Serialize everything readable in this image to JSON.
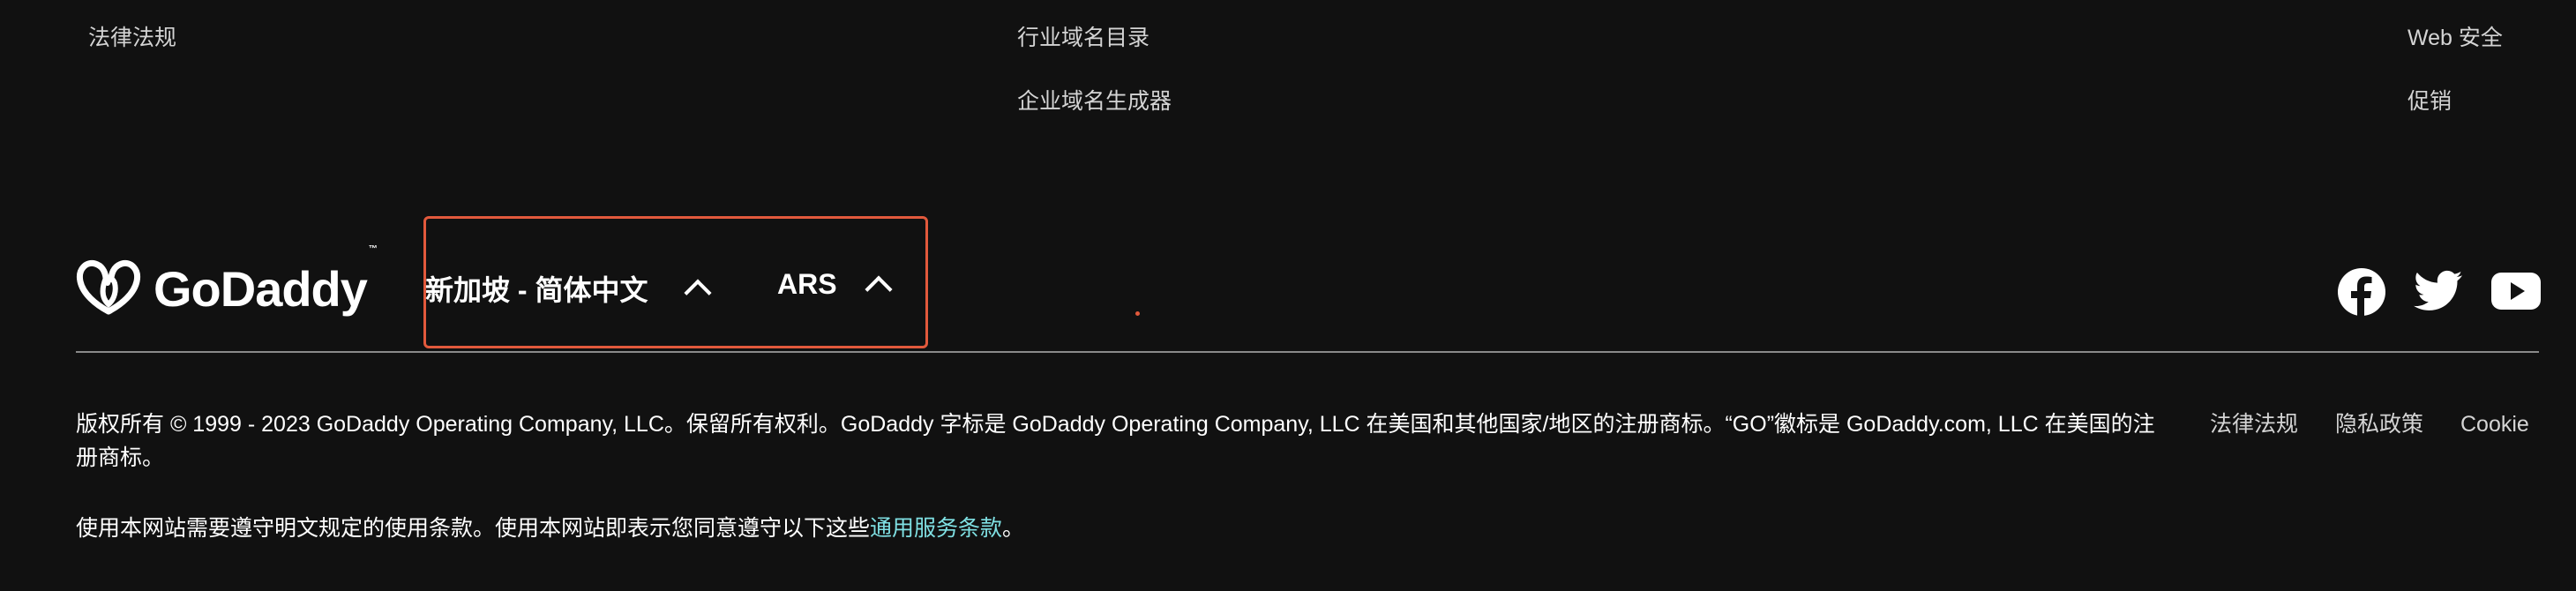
{
  "top_links": {
    "col1": [
      "法律法规"
    ],
    "col2": [
      "行业域名目录",
      "企业域名生成器"
    ],
    "col3": [
      "Web 安全",
      "促销"
    ]
  },
  "brand": {
    "logo_text": "GoDaddy",
    "trademark": "™"
  },
  "selectors": {
    "region_language": "新加坡 - 简体中文",
    "currency": "ARS"
  },
  "social_icons": [
    "facebook-icon",
    "twitter-icon",
    "youtube-icon"
  ],
  "legal": {
    "copyright": "版权所有 © 1999 - 2023 GoDaddy Operating Company, LLC。保留所有权利。GoDaddy 字标是 GoDaddy Operating Company, LLC 在美国和其他国家/地区的注册商标。“GO”徽标是 GoDaddy.com, LLC 在美国的注册商标。",
    "terms_prefix": "使用本网站需要遵守明文规定的使用条款。使用本网站即表示您同意遵守以下这些",
    "terms_link": "通用服务条款",
    "terms_suffix": "。"
  },
  "bottom_links": [
    "法律法规",
    "隐私政策",
    "Cookie"
  ],
  "colors": {
    "background": "#111111",
    "highlight_border": "#e2593c",
    "terms_link": "#7fe0e3",
    "divider": "#8a8a8a"
  }
}
